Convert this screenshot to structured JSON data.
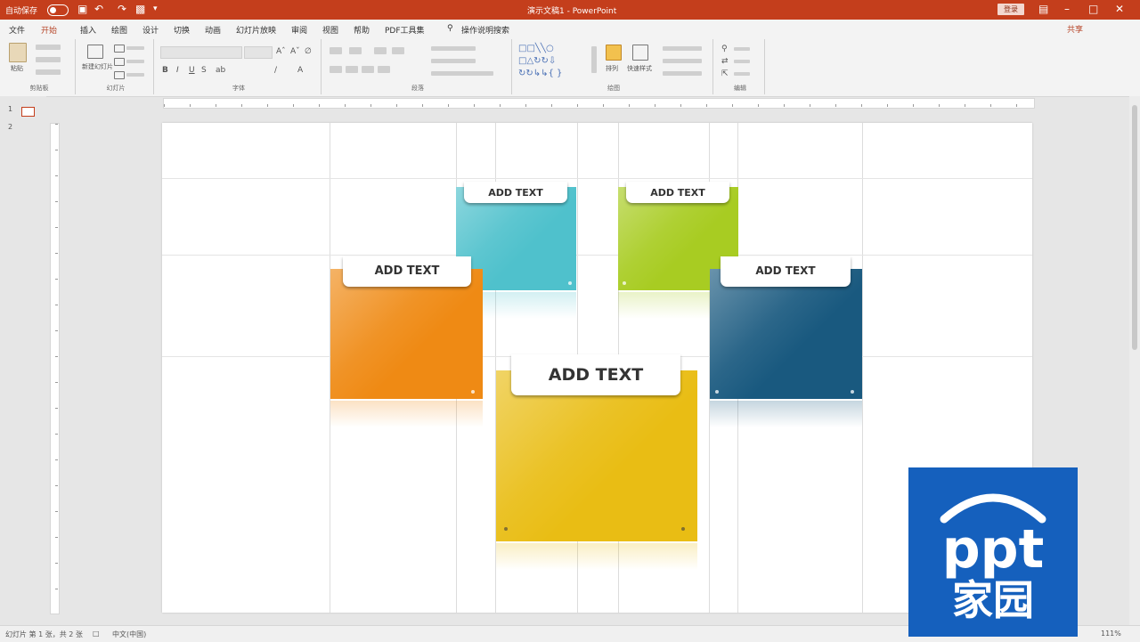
{
  "titlebar": {
    "autosave_label": "自动保存",
    "doc_title": "演示文稿1 - PowerPoint",
    "signin_label": "登录",
    "qat_icons": [
      "save-icon",
      "undo-icon",
      "redo-icon",
      "customize-icon"
    ]
  },
  "tabs": [
    "文件",
    "开始",
    "插入",
    "绘图",
    "设计",
    "切换",
    "动画",
    "幻灯片放映",
    "审阅",
    "视图",
    "帮助",
    "PDF工具集",
    "操作说明搜索"
  ],
  "active_tab": "开始",
  "share_label": "共享",
  "ribbon": {
    "groups": [
      "剪贴板",
      "幻灯片",
      "字体",
      "段落",
      "绘图",
      "编辑"
    ],
    "clipboard": {
      "paste": "粘贴"
    },
    "slides": {
      "new_slide": "新建幻灯片"
    },
    "drawing": {
      "arrange": "排列",
      "quick_styles": "快速样式"
    }
  },
  "slide_cards": [
    {
      "label": "ADD TEXT",
      "color": "#4fc1cc"
    },
    {
      "label": "ADD TEXT",
      "color": "#a8cc22"
    },
    {
      "label": "ADD TEXT",
      "color": "#ef8a14"
    },
    {
      "label": "ADD TEXT",
      "color": "#19597f"
    },
    {
      "label": "ADD TEXT",
      "color": "#e9bd14"
    }
  ],
  "thumbnail_numbers": [
    "1",
    "2"
  ],
  "status": {
    "slide_counter": "幻灯片 第 1 张，共 2 张",
    "language": "中文(中国)",
    "zoom": "111%"
  },
  "logo": {
    "color": "#1560bd",
    "text_top": "ppt",
    "text_bottom": "家园"
  }
}
